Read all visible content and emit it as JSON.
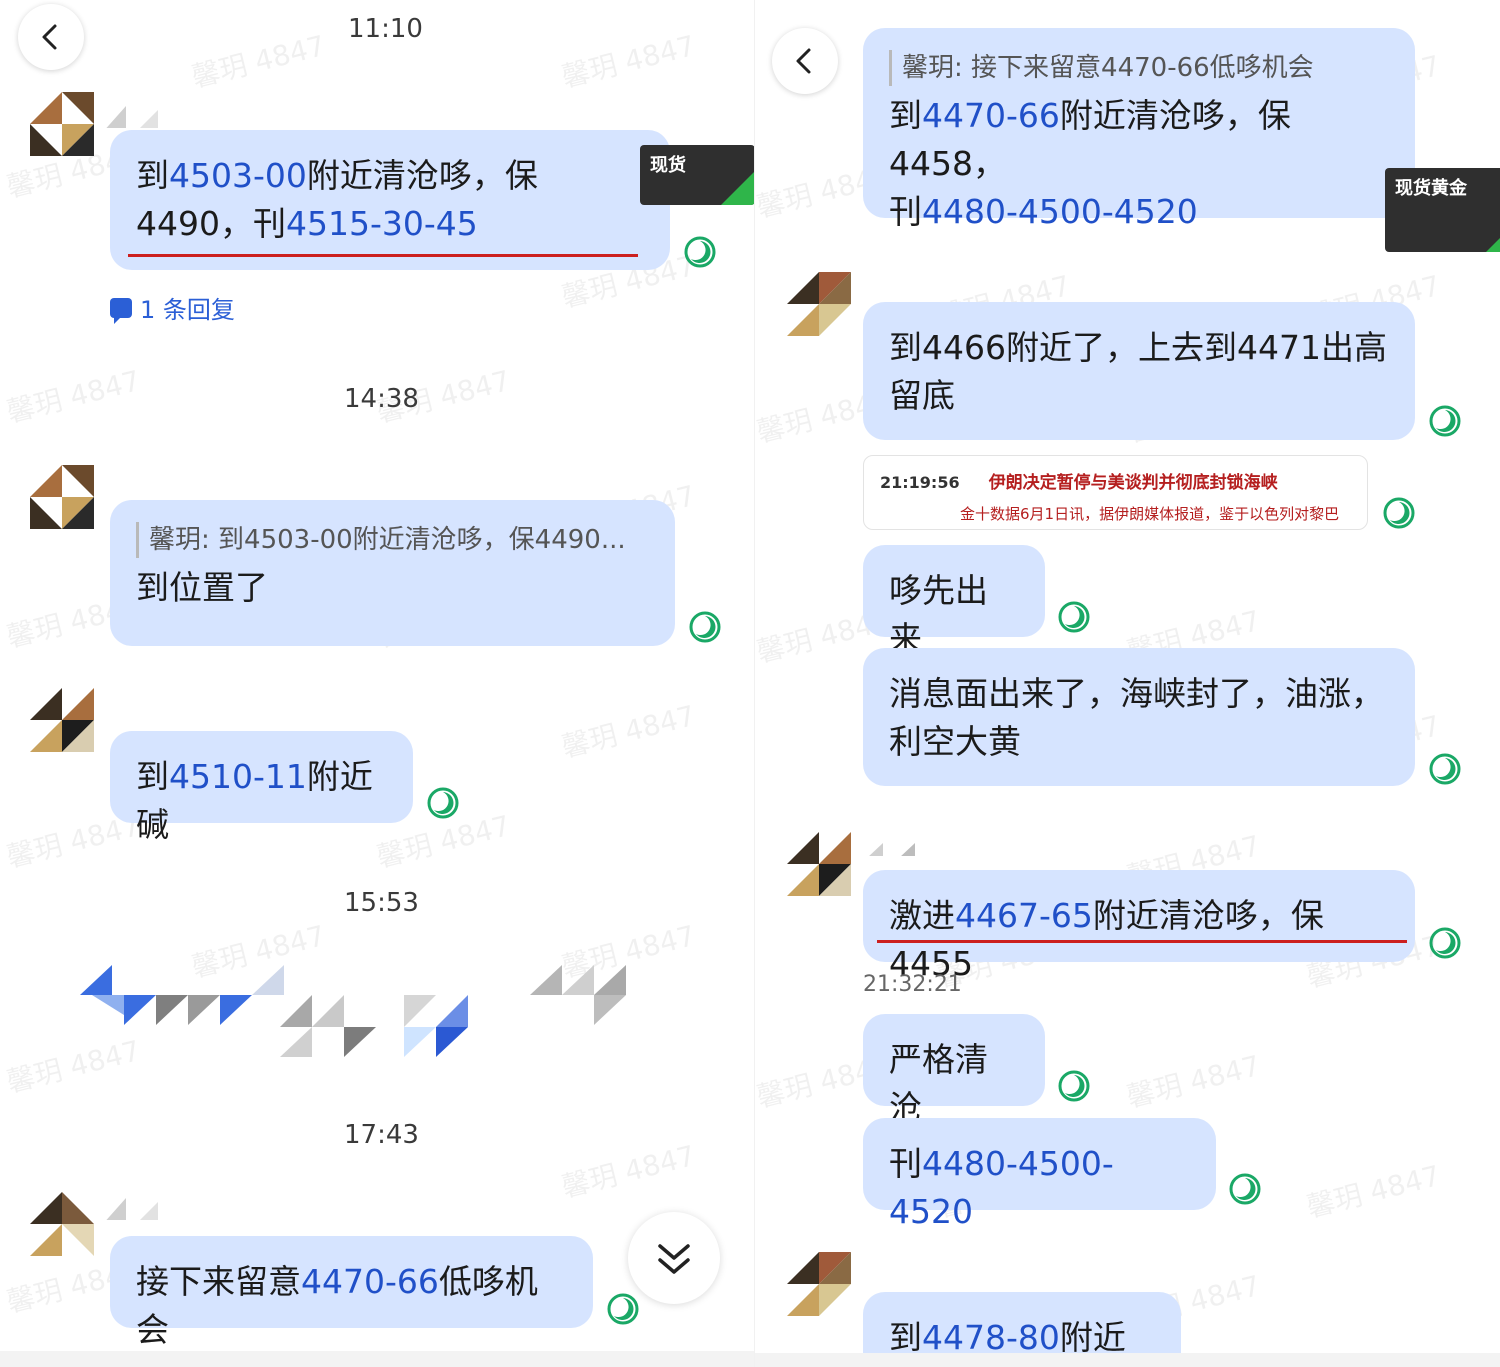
{
  "left": {
    "time_1110": "11:10",
    "msg1": {
      "p1": "到",
      "h1": "4503-00",
      "p2": "附近清沧哆，保",
      "p3": "4490，刊",
      "h2": "4515-30-45"
    },
    "reply_count": "1 条回复",
    "time_1438": "14:38",
    "msg2": {
      "quote": "馨玥: 到4503-00附近清沧哆，保4490...",
      "text": "到位置了"
    },
    "msg3": {
      "p1": "到",
      "h1": "4510-11",
      "p2": "附近碱"
    },
    "time_1553": "15:53",
    "time_1743": "17:43",
    "msg4": {
      "p1": "接下来留意",
      "h1": "4470-66",
      "p2": "低哆机会"
    }
  },
  "right": {
    "msg1": {
      "quote": "馨玥: 接下来留意4470-66低哆机会",
      "p1": "到",
      "h1": "4470-66",
      "p2": "附近清沧哆，保4458，",
      "p3": "刊",
      "h2": "4480-4500-4520"
    },
    "msg2": {
      "text": "到4466附近了，上去到4471出高留底"
    },
    "news": {
      "time": "21:19:56",
      "title": "伊朗决定暂停与美谈判并彻底封锁海峡",
      "body": "金十数据6月1日讯，据伊朗媒体报道，鉴于以色列对黎巴"
    },
    "msg3": {
      "text": "哆先出来"
    },
    "msg4": {
      "text": "消息面出来了，海峡封了，油涨，利空大黄"
    },
    "msg5": {
      "p1": "激进",
      "h1": "4467-65",
      "p2": "附近清沧哆，保4455"
    },
    "timestamp": "21:32:21",
    "msg6": {
      "text": "严格清沧"
    },
    "msg7": {
      "p1": "刊",
      "h1": "4480-4500-4520"
    },
    "msg8": {
      "p1": "到",
      "h1": "4478-80",
      "p2": "附近碱"
    }
  },
  "stamp_left": "现货",
  "stamp_right": "现货黄金",
  "watermark": "馨玥 4847",
  "colors": {
    "bubble": "#d6e4ff",
    "highlight": "#2050c8",
    "status": "#1aa866",
    "underline": "#cc1f1f"
  }
}
